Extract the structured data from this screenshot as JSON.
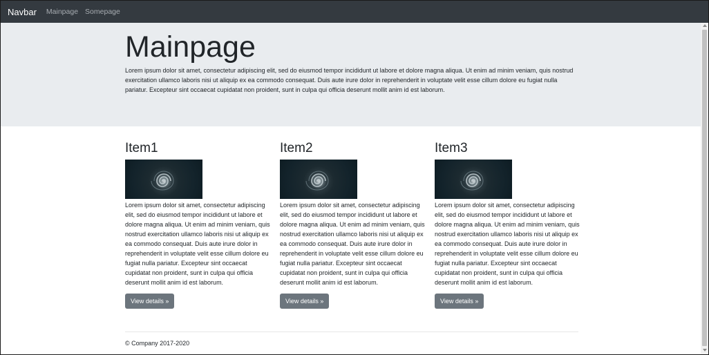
{
  "navbar": {
    "brand": "Navbar",
    "links": [
      {
        "label": "Mainpage"
      },
      {
        "label": "Somepage"
      }
    ]
  },
  "jumbotron": {
    "title": "Mainpage",
    "text": "Lorem ipsum dolor sit amet, consectetur adipiscing elit, sed do eiusmod tempor incididunt ut labore et dolore magna aliqua. Ut enim ad minim veniam, quis nostrud exercitation ullamco laboris nisi ut aliquip ex ea commodo consequat. Duis aute irure dolor in reprehenderit in voluptate velit esse cillum dolore eu fugiat nulla pariatur. Excepteur sint occaecat cupidatat non proident, sunt in culpa qui officia deserunt mollit anim id est laborum."
  },
  "items": [
    {
      "title": "Item1",
      "text": "Lorem ipsum dolor sit amet, consectetur adipiscing elit, sed do eiusmod tempor incididunt ut labore et dolore magna aliqua. Ut enim ad minim veniam, quis nostrud exercitation ullamco laboris nisi ut aliquip ex ea commodo consequat. Duis aute irure dolor in reprehenderit in voluptate velit esse cillum dolore eu fugiat nulla pariatur. Excepteur sint occaecat cupidatat non proident, sunt in culpa qui officia deserunt mollit anim id est laborum.",
      "button": "View details »"
    },
    {
      "title": "Item2",
      "text": "Lorem ipsum dolor sit amet, consectetur adipiscing elit, sed do eiusmod tempor incididunt ut labore et dolore magna aliqua. Ut enim ad minim veniam, quis nostrud exercitation ullamco laboris nisi ut aliquip ex ea commodo consequat. Duis aute irure dolor in reprehenderit in voluptate velit esse cillum dolore eu fugiat nulla pariatur. Excepteur sint occaecat cupidatat non proident, sunt in culpa qui officia deserunt mollit anim id est laborum.",
      "button": "View details »"
    },
    {
      "title": "Item3",
      "text": "Lorem ipsum dolor sit amet, consectetur adipiscing elit, sed do eiusmod tempor incididunt ut labore et dolore magna aliqua. Ut enim ad minim veniam, quis nostrud exercitation ullamco laboris nisi ut aliquip ex ea commodo consequat. Duis aute irure dolor in reprehenderit in voluptate velit esse cillum dolore eu fugiat nulla pariatur. Excepteur sint occaecat cupidatat non proident, sunt in culpa qui officia deserunt mollit anim id est laborum.",
      "button": "View details »"
    }
  ],
  "footer": {
    "text": "© Company 2017-2020"
  },
  "colors": {
    "navbar_bg": "#343a40",
    "jumbotron_bg": "#e9ecef",
    "button_bg": "#6c757d",
    "text": "#212529",
    "nav_link": "#a8adb2"
  },
  "icons": {
    "item_image": "spiral-image"
  }
}
